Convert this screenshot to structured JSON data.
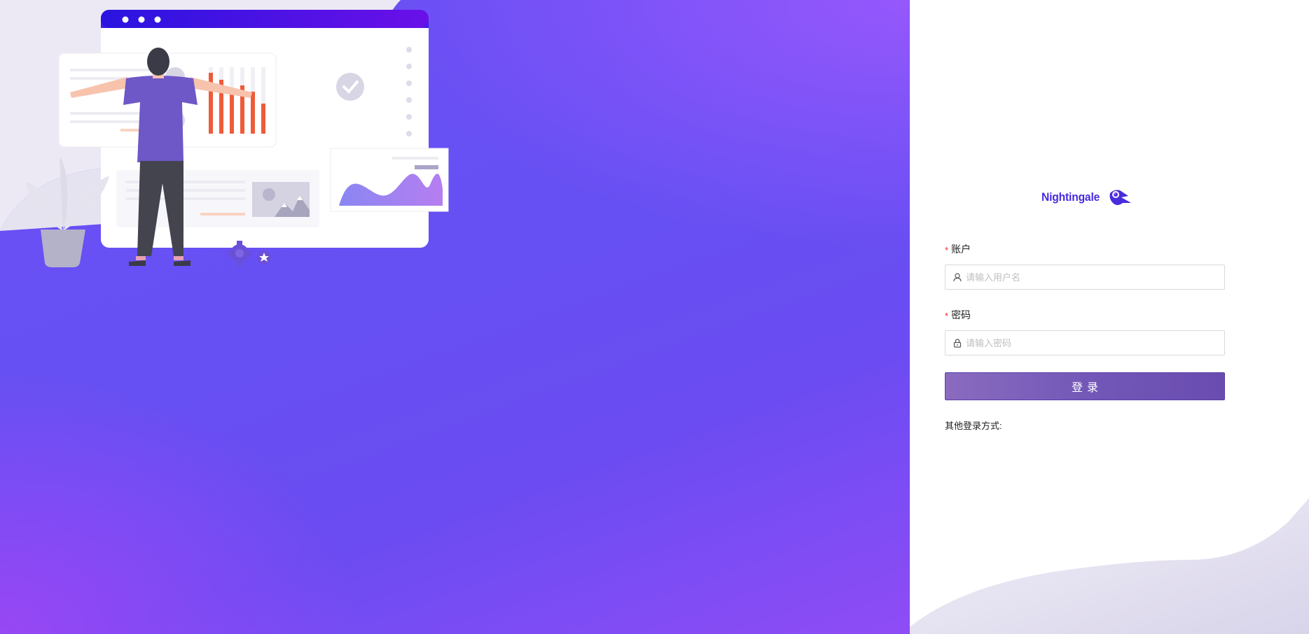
{
  "brand": {
    "name": "Nightingale",
    "color": "#4a2bde"
  },
  "form": {
    "username": {
      "label": "账户",
      "required_mark": "*",
      "placeholder": "请输入用户名",
      "value": "",
      "icon": "user-icon"
    },
    "password": {
      "label": "密码",
      "required_mark": "*",
      "placeholder": "请输入密码",
      "value": "",
      "icon": "lock-icon"
    },
    "submit_label": "登录",
    "other_login_label": "其他登录方式:"
  },
  "colors": {
    "panel_gradient_start": "#6a4ff5",
    "panel_gradient_end": "#8f4cf5",
    "button": "#7358b8",
    "required": "#f5222d",
    "illustration_bars": "#ef5b3a"
  }
}
